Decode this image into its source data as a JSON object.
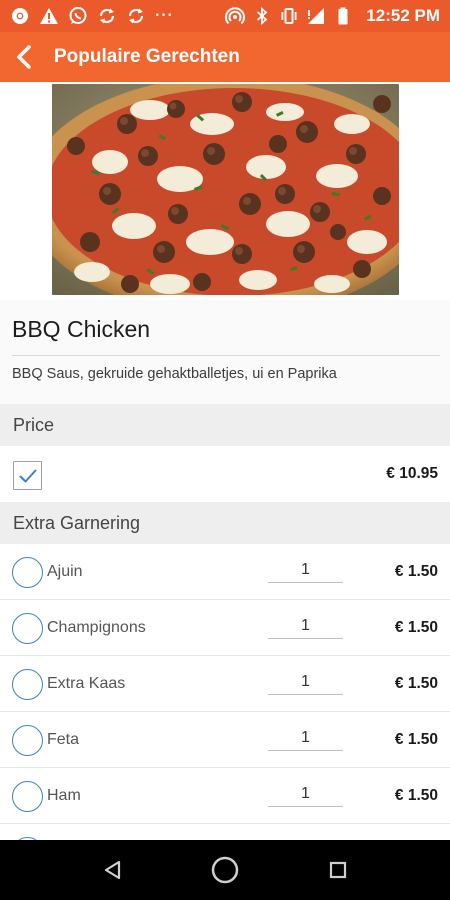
{
  "status_bar": {
    "time": "12:52 PM",
    "dots": "···",
    "icons": [
      "chrome-icon",
      "warning-icon",
      "whatsapp-icon",
      "sync-icon",
      "sync-icon",
      "hotspot-icon",
      "bluetooth-icon",
      "vibrate-icon",
      "signal-icon",
      "battery-icon"
    ]
  },
  "app_bar": {
    "title": "Populaire Gerechten",
    "back_icon": "chevron-left-icon",
    "color": "#f26630"
  },
  "dish": {
    "name": "BBQ Chicken",
    "description": "BBQ Saus, gekruide gehaktballetjes, ui en Paprika"
  },
  "price_section": {
    "header": "Price",
    "checked": true,
    "value": "€ 10.95"
  },
  "extras_section": {
    "header": "Extra Garnering",
    "items": [
      {
        "label": "Ajuin",
        "qty": "1",
        "price": "€ 1.50"
      },
      {
        "label": "Champignons",
        "qty": "1",
        "price": "€ 1.50"
      },
      {
        "label": "Extra Kaas",
        "qty": "1",
        "price": "€ 1.50"
      },
      {
        "label": "Feta",
        "qty": "1",
        "price": "€ 1.50"
      },
      {
        "label": "Ham",
        "qty": "1",
        "price": "€ 1.50"
      }
    ]
  },
  "nav_bar": {
    "icons": [
      "back-triangle-icon",
      "home-circle-icon",
      "recents-square-icon"
    ]
  },
  "colors": {
    "accent": "#f26630",
    "status": "#ea5a2b",
    "selection": "#3d7fc9"
  }
}
